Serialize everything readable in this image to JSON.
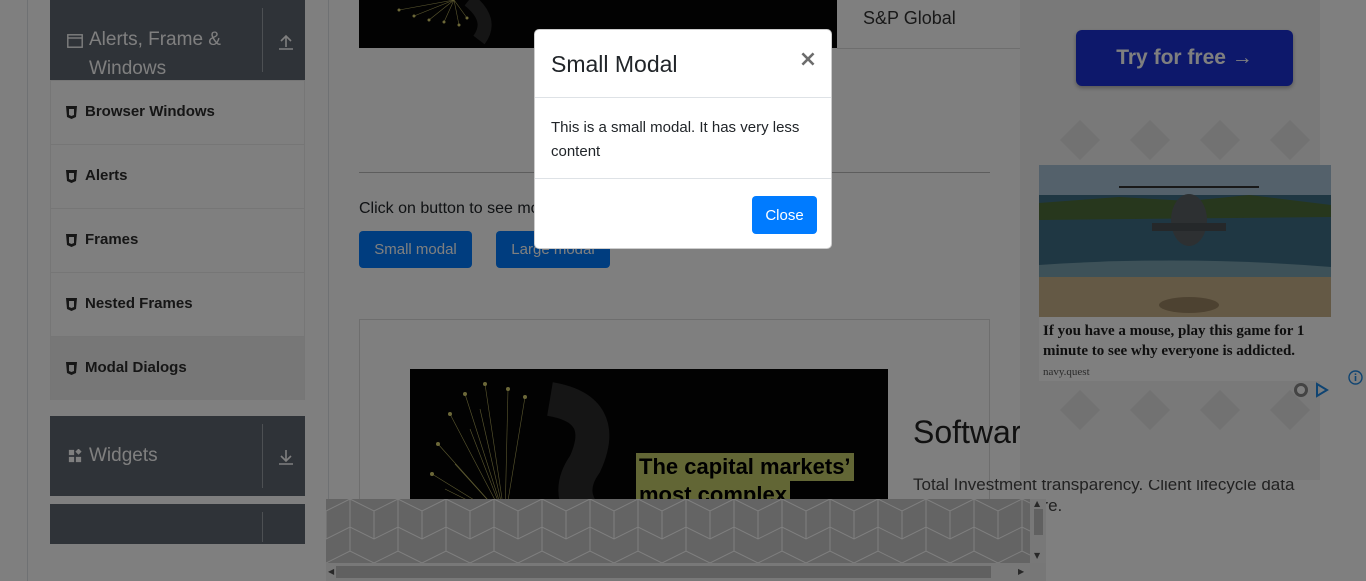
{
  "sidebar": {
    "groups": [
      {
        "title": "Alerts, Frame & Windows",
        "icon": "window-icon",
        "toggle_icon": "collapse-arrow-up-icon"
      },
      {
        "title": "Widgets",
        "icon": "widgets-grid-icon",
        "toggle_icon": "expand-arrow-down-icon"
      }
    ],
    "items": [
      {
        "label": "Browser Windows",
        "icon": "html5-icon"
      },
      {
        "label": "Alerts",
        "icon": "html5-icon"
      },
      {
        "label": "Frames",
        "icon": "html5-icon"
      },
      {
        "label": "Nested Frames",
        "icon": "html5-icon"
      },
      {
        "label": "Modal Dialogs",
        "icon": "html5-icon",
        "active": true
      }
    ]
  },
  "main": {
    "ad_top_caption": "S&P Global",
    "instruction": "Click on button to see modal",
    "buttons": {
      "small": "Small modal",
      "large": "Large modal"
    },
    "ad_bottom": {
      "headline_lines": [
        "The capital markets’",
        "most complex"
      ],
      "title": "Software",
      "body": "Total Investment transparency. Client lifecycle data silos. Explore more."
    }
  },
  "side_ad": {
    "cta": "Try for free →",
    "promo_text": "If you have a mouse, play this game for 1 minute to see why everyone is addicted.",
    "promo_source": "navy.quest"
  },
  "modal": {
    "title": "Small Modal",
    "close_symbol": "×",
    "body": "This is a small modal. It has very less content",
    "close_button": "Close"
  },
  "colors": {
    "primary": "#007bff",
    "sidebar_header": "#5f6670",
    "cta_blue": "#1a30d6"
  }
}
